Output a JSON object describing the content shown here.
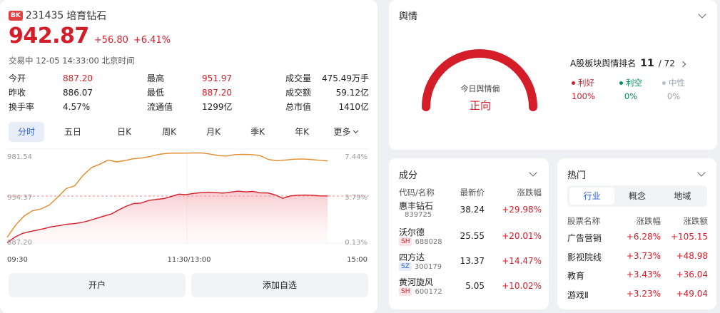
{
  "header": {
    "badge": "BK",
    "code": "231435",
    "name": "培育钻石"
  },
  "quote": {
    "price": "942.87",
    "change": "+56.80",
    "change_pct": "+6.41%",
    "status": "交易中 12-05 14:33:00 北京时间"
  },
  "stats": [
    [
      {
        "label": "今开",
        "value": "887.20",
        "color": "up"
      },
      {
        "label": "最高",
        "value": "951.97",
        "color": "up"
      },
      {
        "label": "成交量",
        "value": "475.49万手",
        "color": "plain"
      }
    ],
    [
      {
        "label": "昨收",
        "value": "886.07",
        "color": "plain"
      },
      {
        "label": "最低",
        "value": "887.20",
        "color": "up"
      },
      {
        "label": "成交额",
        "value": "59.12亿",
        "color": "plain"
      }
    ],
    [
      {
        "label": "换手率",
        "value": "4.57%",
        "color": "plain"
      },
      {
        "label": "流通值",
        "value": "1299亿",
        "color": "plain"
      },
      {
        "label": "总市值",
        "value": "1410亿",
        "color": "plain"
      }
    ]
  ],
  "tabs": [
    "分时",
    "五日",
    "日K",
    "周K",
    "月K",
    "季K",
    "年K",
    "更多"
  ],
  "active_tab": 0,
  "chart_data": {
    "type": "line",
    "y_left_ticks": [
      "981.54",
      "934.37",
      "887.20"
    ],
    "y_right_ticks": [
      "7.44%",
      "3.79%",
      "0.13%"
    ],
    "x_ticks": [
      "09:30",
      "11:30/13:00",
      "15:00"
    ],
    "series": [
      {
        "role": "index",
        "color": "#d51d2a",
        "values": [
          887.6,
          893.0,
          896.8,
          898.7,
          900.2,
          901.8,
          903.7,
          904.8,
          906.2,
          906.7,
          907.9,
          909.8,
          912.1,
          914.3,
          916.4,
          920.6,
          924.3,
          926.9,
          927.4,
          930.0,
          931.0,
          931.9,
          933.9,
          936.3,
          935.9,
          937.0,
          937.8,
          938.2,
          937.8,
          937.4,
          938.4,
          939.3,
          938.6,
          939.0,
          937.5,
          937.5,
          935.5,
          932.1,
          934.5,
          935.2,
          935.4,
          935.2,
          934.5,
          934.5
        ]
      },
      {
        "role": "avg",
        "color": "#e48a2a",
        "values": [
          893.0,
          905.2,
          914.3,
          919.6,
          921.5,
          925.3,
          933.3,
          941.9,
          944.5,
          955.0,
          962.9,
          966.3,
          970.5,
          968.6,
          970.1,
          971.8,
          972.5,
          974.0,
          976.2,
          977.2,
          977.5,
          977.4,
          977.6,
          977.7,
          976.6,
          975.0,
          974.5,
          976.0,
          976.2,
          976.0,
          974.9,
          971.0,
          969.8,
          970.5,
          971.3,
          971.6,
          971.0,
          970.3,
          969.6
        ]
      }
    ],
    "reference_line": 934.37,
    "ylim": [
      887.2,
      981.54
    ]
  },
  "actions": {
    "open_account": "开户",
    "add_watch": "添加自选"
  },
  "sentiment": {
    "title": "舆情",
    "gauge_caption": "今日舆情偏",
    "gauge_value": "正向",
    "gauge_level": 1.0,
    "rank_label": "A股板块舆情排名",
    "rank": "11",
    "rank_total": "/ 72",
    "legend": [
      {
        "label": "利好",
        "pct": "100%",
        "color": "#d51d2a"
      },
      {
        "label": "利空",
        "pct": "0%",
        "color": "#0b8a5a"
      },
      {
        "label": "中性",
        "pct": "0%",
        "color": "#9aa0a8"
      }
    ]
  },
  "components": {
    "title": "成分",
    "headers": [
      "代码/名称",
      "最新价",
      "涨跌幅"
    ],
    "rows": [
      {
        "name": "惠丰钻石",
        "market": "",
        "code": "839725",
        "price": "38.24",
        "change": "+29.98%"
      },
      {
        "name": "沃尔德",
        "market": "SH",
        "code": "688028",
        "price": "25.55",
        "change": "+20.01%"
      },
      {
        "name": "四方达",
        "market": "SZ",
        "code": "300179",
        "price": "13.37",
        "change": "+14.47%"
      },
      {
        "name": "黄河旋风",
        "market": "SH",
        "code": "600172",
        "price": "5.05",
        "change": "+10.02%"
      }
    ]
  },
  "hot": {
    "title": "热门",
    "tabs": [
      "行业",
      "概念",
      "地域"
    ],
    "active_tab": 0,
    "headers": [
      "股票名称",
      "涨跌幅",
      "涨跌额"
    ],
    "rows": [
      {
        "name": "广告营销",
        "pct": "+6.28%",
        "amt": "+105.15"
      },
      {
        "name": "影视院线",
        "pct": "+3.73%",
        "amt": "+48.98"
      },
      {
        "name": "教育",
        "pct": "+3.43%",
        "amt": "+36.04"
      },
      {
        "name": "游戏Ⅱ",
        "pct": "+3.23%",
        "amt": "+49.04"
      }
    ]
  }
}
